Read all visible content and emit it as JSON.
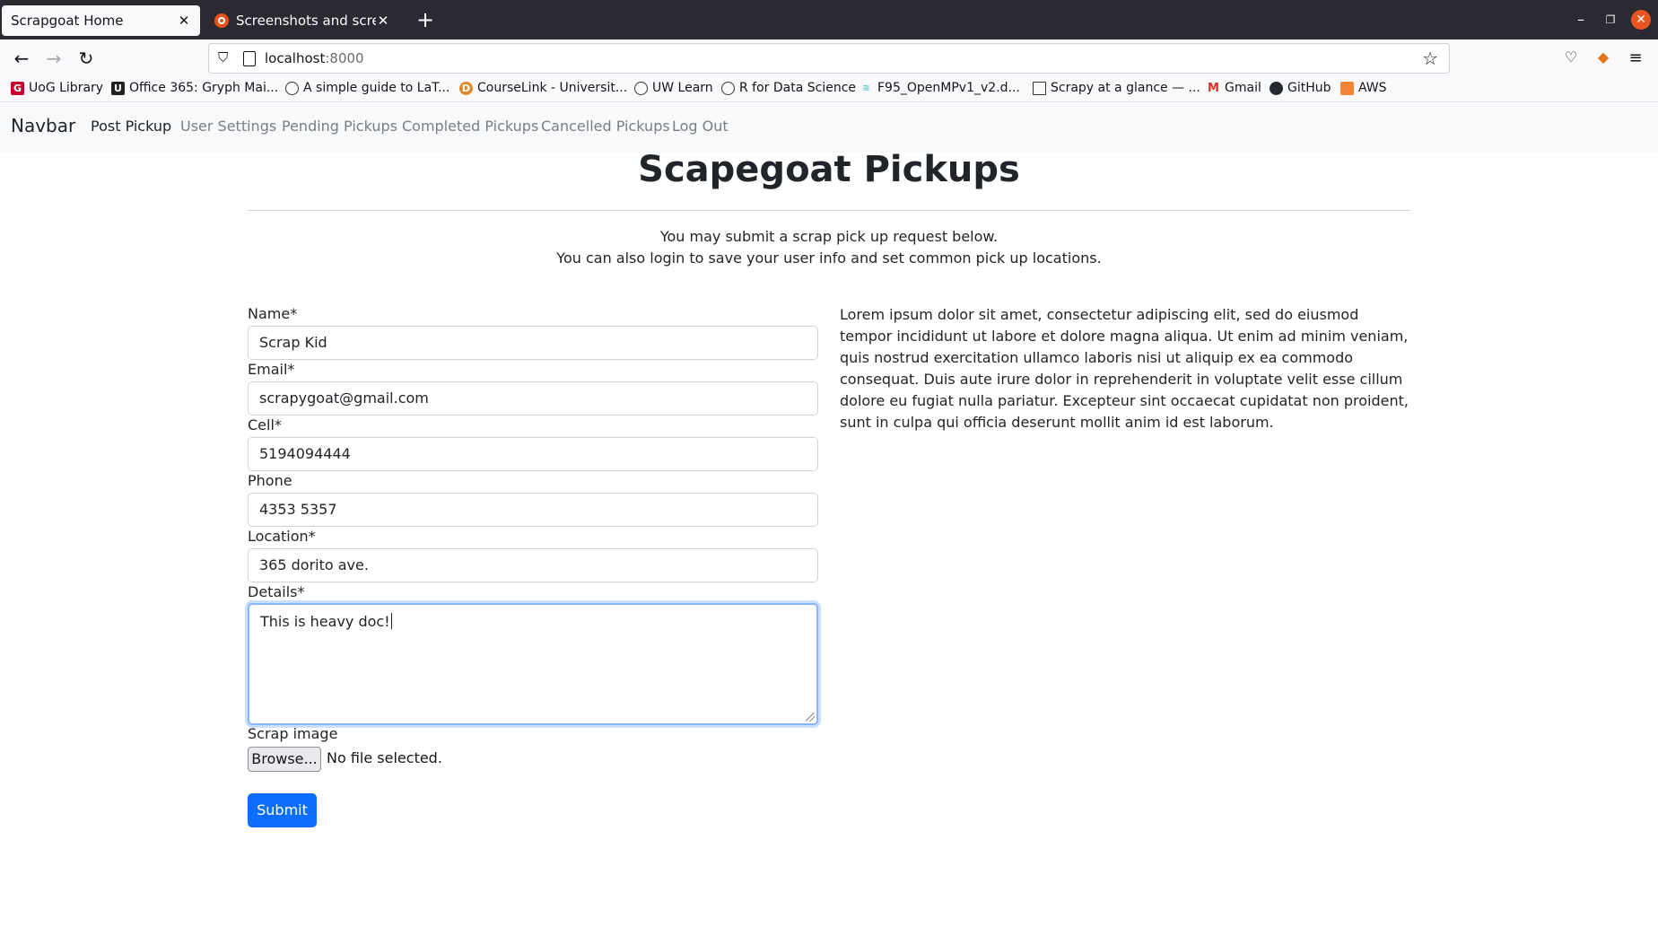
{
  "browser": {
    "tabs": [
      {
        "title": "Scrapgoat Home",
        "active": true
      },
      {
        "title": "Screenshots and screencasts",
        "active": false
      }
    ],
    "url_host": "localhost",
    "url_port": ":8000",
    "bookmarks": [
      {
        "label": "UoG Library",
        "icon": "uog-library-icon"
      },
      {
        "label": "Office 365: Gryph Mai...",
        "icon": "office-365-icon"
      },
      {
        "label": "A simple guide to LaT...",
        "icon": "globe-icon"
      },
      {
        "label": "CourseLink - Universit...",
        "icon": "courselink-icon"
      },
      {
        "label": "UW Learn",
        "icon": "globe-icon"
      },
      {
        "label": "R for Data Science",
        "icon": "globe-icon"
      },
      {
        "label": "F95_OpenMPv1_v2.d...",
        "icon": "document-icon"
      },
      {
        "label": "Scrapy at a glance — ...",
        "icon": "scrapy-docs-icon"
      },
      {
        "label": "Gmail",
        "icon": "gmail-icon"
      },
      {
        "label": "GitHub",
        "icon": "github-icon"
      },
      {
        "label": "AWS",
        "icon": "aws-icon"
      }
    ]
  },
  "navbar": {
    "brand": "Navbar",
    "links": [
      {
        "label": "Post Pickup",
        "active": true
      },
      {
        "label": "User Settings",
        "active": false
      },
      {
        "label": "Pending Pickups",
        "active": false
      },
      {
        "label": "Completed Pickups",
        "active": false
      },
      {
        "label": "Cancelled Pickups",
        "active": false
      },
      {
        "label": "Log Out",
        "active": false
      }
    ]
  },
  "page": {
    "title": "Scapegoat Pickups",
    "intro_line1": "You may submit a scrap pick up request below.",
    "intro_line2": "You can also login to save your user info and set common pick up locations."
  },
  "form": {
    "name": {
      "label": "Name*",
      "value": "Scrap Kid"
    },
    "email": {
      "label": "Email*",
      "value": "scrapygoat@gmail.com"
    },
    "cell": {
      "label": "Cell*",
      "value": "5194094444"
    },
    "phone": {
      "label": "Phone",
      "value": "4353 5357"
    },
    "location": {
      "label": "Location*",
      "value": "365 dorito ave."
    },
    "details": {
      "label": "Details*",
      "value": "This is heavy doc!"
    },
    "image": {
      "label": "Scrap image",
      "browse_label": "Browse...",
      "status": "No file selected."
    },
    "submit_label": "Submit"
  },
  "sidebar_text": "Lorem ipsum dolor sit amet, consectetur adipiscing elit, sed do eiusmod tempor incididunt ut labore et dolore magna aliqua. Ut enim ad minim veniam, quis nostrud exercitation ullamco laboris nisi ut aliquip ex ea commodo consequat. Duis aute irure dolor in reprehenderit in voluptate velit esse cillum dolore eu fugiat nulla pariatur. Excepteur sint occaecat cupidatat non proident, sunt in culpa qui officia deserunt mollit anim id est laborum.",
  "colors": {
    "primary": "#0d6efd",
    "navbar_bg": "#f8f9fa",
    "tabbar_bg": "#2b2a33",
    "close_button": "#e95420"
  }
}
